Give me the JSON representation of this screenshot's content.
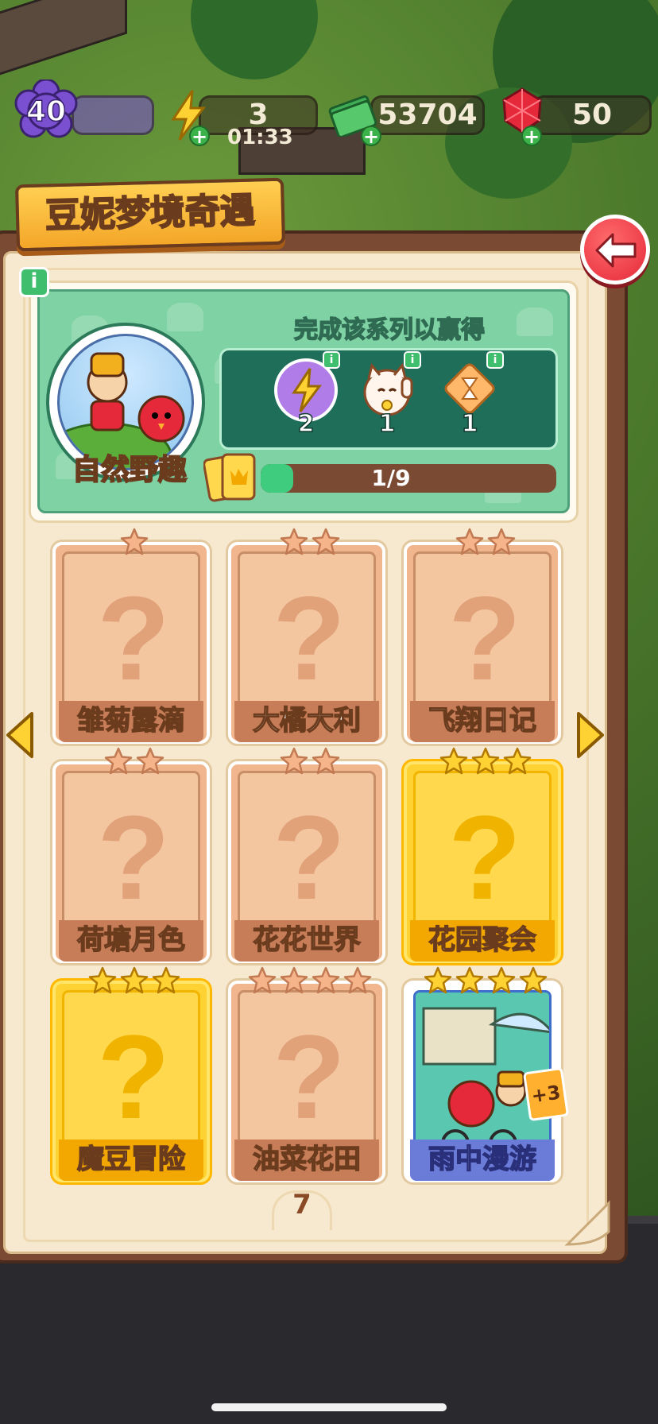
{
  "hud": {
    "level": "40",
    "energy": "3",
    "energy_timer": "01:33",
    "coins": "53704",
    "gems": "50"
  },
  "title": "豆妮梦境奇遇",
  "series": {
    "name": "自然野趣",
    "reward_title": "完成该系列以赢得",
    "rewards": [
      {
        "icon": "lightning-orb-icon",
        "count": "2"
      },
      {
        "icon": "lucky-cat-icon",
        "count": "1"
      },
      {
        "icon": "hourglass-tile-icon",
        "count": "1"
      }
    ],
    "progress_text": "1/9",
    "progress_fraction": 0.111
  },
  "cards": [
    {
      "name": "雏菊露滴",
      "stars": 1,
      "style": "normal",
      "revealed": false
    },
    {
      "name": "大橘大利",
      "stars": 2,
      "style": "normal",
      "revealed": false
    },
    {
      "name": "飞翔日记",
      "stars": 2,
      "style": "normal",
      "revealed": false
    },
    {
      "name": "荷塘月色",
      "stars": 2,
      "style": "normal",
      "revealed": false
    },
    {
      "name": "花花世界",
      "stars": 2,
      "style": "normal",
      "revealed": false
    },
    {
      "name": "花园聚会",
      "stars": 3,
      "style": "gold",
      "revealed": false
    },
    {
      "name": "魔豆冒险",
      "stars": 3,
      "style": "gold",
      "revealed": false
    },
    {
      "name": "油菜花田",
      "stars": 4,
      "style": "normal",
      "revealed": false
    },
    {
      "name": "雨中漫游",
      "stars": 4,
      "style": "blue",
      "revealed": true,
      "bonus": "+3"
    }
  ],
  "page_number": "7",
  "colors": {
    "green_accent": "#3fcc7f",
    "brown": "#7a4a33",
    "gold": "#ffd234",
    "red_button": "#e5293b"
  }
}
